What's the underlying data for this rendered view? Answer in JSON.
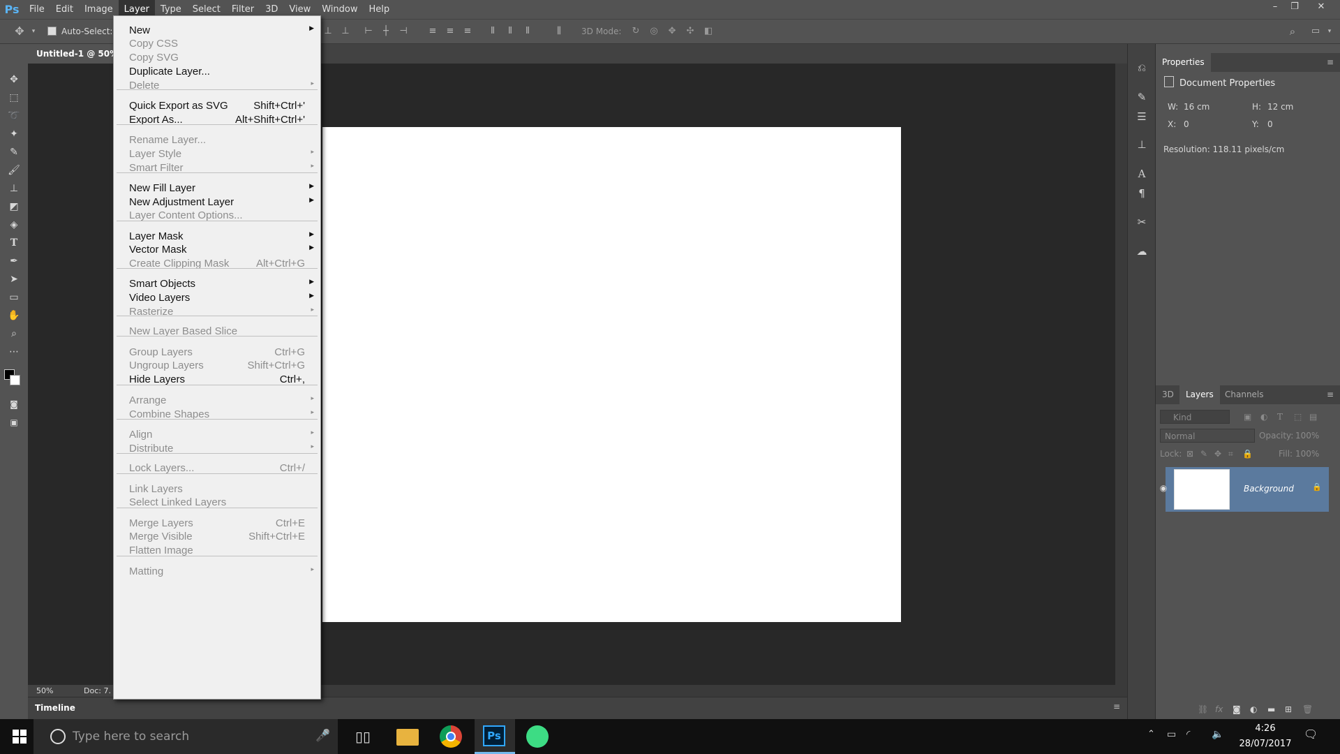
{
  "app": {
    "logo": "Ps",
    "window_min": "–",
    "window_restore": "❐",
    "window_close": "✕"
  },
  "menubar": [
    "File",
    "Edit",
    "Image",
    "Layer",
    "Type",
    "Select",
    "Filter",
    "3D",
    "View",
    "Window",
    "Help"
  ],
  "options": {
    "auto_select": "Auto-Select:",
    "mode3d": "3D Mode:"
  },
  "document": {
    "tab": "Untitled-1 @ 50%",
    "zoom": "50%",
    "doc_info": "Doc: 7."
  },
  "timeline": "Timeline",
  "properties": {
    "tab": "Properties",
    "title": "Document Properties",
    "w_label": "W:",
    "w": "16 cm",
    "h_label": "H:",
    "h": "12 cm",
    "x_label": "X:",
    "x": "0",
    "y_label": "Y:",
    "y": "0",
    "resolution": "Resolution: 118.11 pixels/cm"
  },
  "layers_panel": {
    "tabs": [
      "3D",
      "Layers",
      "Channels"
    ],
    "kind": "Kind",
    "blend": "Normal",
    "opacity_label": "Opacity:",
    "opacity": "100%",
    "lock_label": "Lock:",
    "fill_label": "Fill:",
    "fill": "100%",
    "layer_name": "Background"
  },
  "menu": {
    "items": [
      {
        "label": "New",
        "sc": "",
        "arrow": "▶",
        "dis": false
      },
      {
        "label": "Copy CSS",
        "sc": "",
        "arrow": "",
        "dis": true
      },
      {
        "label": "Copy SVG",
        "sc": "",
        "arrow": "",
        "dis": true
      },
      {
        "label": "Duplicate Layer...",
        "sc": "",
        "arrow": "",
        "dis": false
      },
      {
        "label": "Delete",
        "sc": "",
        "arrow": "▸",
        "dis": true
      },
      {
        "label": "Quick Export as SVG",
        "sc": "Shift+Ctrl+'",
        "arrow": "",
        "dis": false
      },
      {
        "label": "Export As...",
        "sc": "Alt+Shift+Ctrl+'",
        "arrow": "",
        "dis": false
      },
      {
        "label": "Rename Layer...",
        "sc": "",
        "arrow": "",
        "dis": true
      },
      {
        "label": "Layer Style",
        "sc": "",
        "arrow": "▸",
        "dis": true
      },
      {
        "label": "Smart Filter",
        "sc": "",
        "arrow": "▸",
        "dis": true
      },
      {
        "label": "New Fill Layer",
        "sc": "",
        "arrow": "▶",
        "dis": false
      },
      {
        "label": "New Adjustment Layer",
        "sc": "",
        "arrow": "▶",
        "dis": false
      },
      {
        "label": "Layer Content Options...",
        "sc": "",
        "arrow": "",
        "dis": true
      },
      {
        "label": "Layer Mask",
        "sc": "",
        "arrow": "▶",
        "dis": false
      },
      {
        "label": "Vector Mask",
        "sc": "",
        "arrow": "▶",
        "dis": false
      },
      {
        "label": "Create Clipping Mask",
        "sc": "Alt+Ctrl+G",
        "arrow": "",
        "dis": true
      },
      {
        "label": "Smart Objects",
        "sc": "",
        "arrow": "▶",
        "dis": false
      },
      {
        "label": "Video Layers",
        "sc": "",
        "arrow": "▶",
        "dis": false
      },
      {
        "label": "Rasterize",
        "sc": "",
        "arrow": "▸",
        "dis": true
      },
      {
        "label": "New Layer Based Slice",
        "sc": "",
        "arrow": "",
        "dis": true
      },
      {
        "label": "Group Layers",
        "sc": "Ctrl+G",
        "arrow": "",
        "dis": true
      },
      {
        "label": "Ungroup Layers",
        "sc": "Shift+Ctrl+G",
        "arrow": "",
        "dis": true
      },
      {
        "label": "Hide Layers",
        "sc": "Ctrl+,",
        "arrow": "",
        "dis": false
      },
      {
        "label": "Arrange",
        "sc": "",
        "arrow": "▸",
        "dis": true
      },
      {
        "label": "Combine Shapes",
        "sc": "",
        "arrow": "▸",
        "dis": true
      },
      {
        "label": "Align",
        "sc": "",
        "arrow": "▸",
        "dis": true
      },
      {
        "label": "Distribute",
        "sc": "",
        "arrow": "▸",
        "dis": true
      },
      {
        "label": "Lock Layers...",
        "sc": "Ctrl+/",
        "arrow": "",
        "dis": true
      },
      {
        "label": "Link Layers",
        "sc": "",
        "arrow": "",
        "dis": true
      },
      {
        "label": "Select Linked Layers",
        "sc": "",
        "arrow": "",
        "dis": true
      },
      {
        "label": "Merge Layers",
        "sc": "Ctrl+E",
        "arrow": "",
        "dis": true
      },
      {
        "label": "Merge Visible",
        "sc": "Shift+Ctrl+E",
        "arrow": "",
        "dis": true
      },
      {
        "label": "Flatten Image",
        "sc": "",
        "arrow": "",
        "dis": true
      },
      {
        "label": "Matting",
        "sc": "",
        "arrow": "▸",
        "dis": true
      }
    ]
  },
  "taskbar": {
    "search_placeholder": "Type here to search",
    "time": "4:26",
    "date": "28/07/2017",
    "ps_label": "Ps"
  }
}
